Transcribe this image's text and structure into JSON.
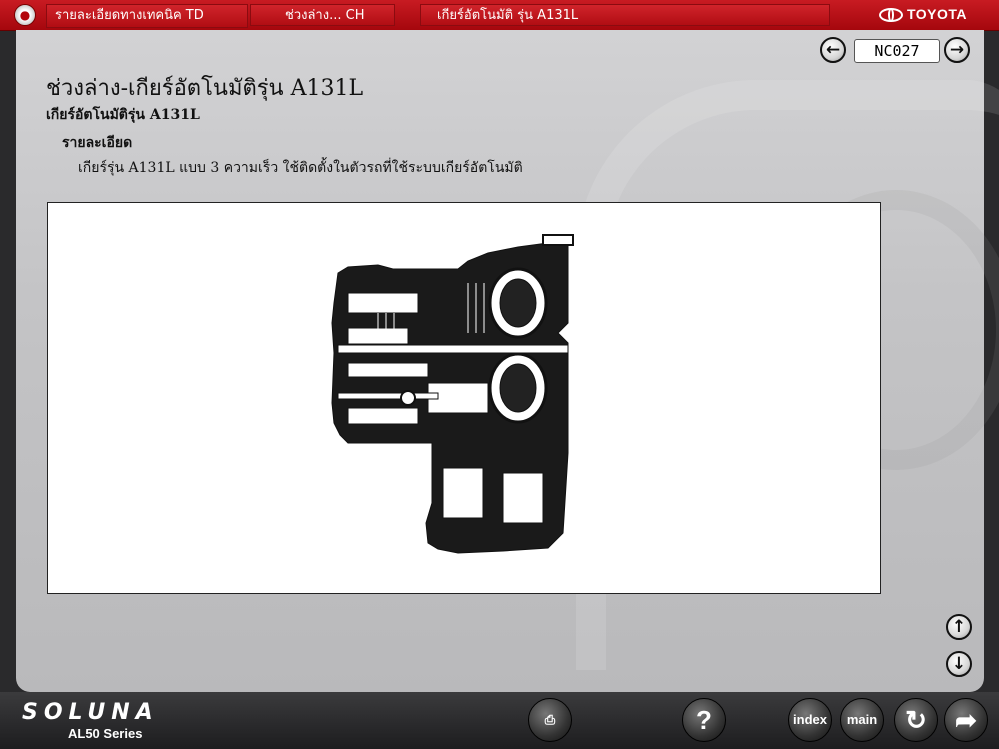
{
  "topbar": {
    "home_icon": "home-icon",
    "crumbs": [
      "รายละเอียดทางเทคนิค TD",
      "ช่วงล่าง... CH",
      "เกียร์อัตโนมัติ รุ่น A131L"
    ],
    "brand": "TOYOTA"
  },
  "nav": {
    "page_code": "NC027",
    "prev_icon": "arrow-left-icon",
    "next_icon": "arrow-right-icon",
    "scroll_up_icon": "arrow-up-icon",
    "scroll_down_icon": "arrow-down-icon"
  },
  "content": {
    "title": "ช่วงล่าง-เกียร์อัตโนมัติรุ่น A131L",
    "subtitle": "เกียร์อัตโนมัติรุ่น A131L",
    "section": "รายละเอียด",
    "description": "เกียร์รุ่น A131L แบบ 3 ความเร็ว ใช้ติดตั้งในตัวรถที่ใช้ระบบเกียร์อัตโนมัติ",
    "figure_icon": "transmission-cutaway-diagram"
  },
  "footer": {
    "model": "SOLUNA",
    "series": "AL50 Series",
    "buttons": {
      "print": "print-icon",
      "help": "?",
      "index": "index",
      "main": "main",
      "back": "back-icon",
      "exit": "exit-icon"
    }
  },
  "colors": {
    "topbar_red": "#b3060c",
    "panel_silver": "#c4c4c6",
    "bottombar": "#2a2a2c"
  }
}
